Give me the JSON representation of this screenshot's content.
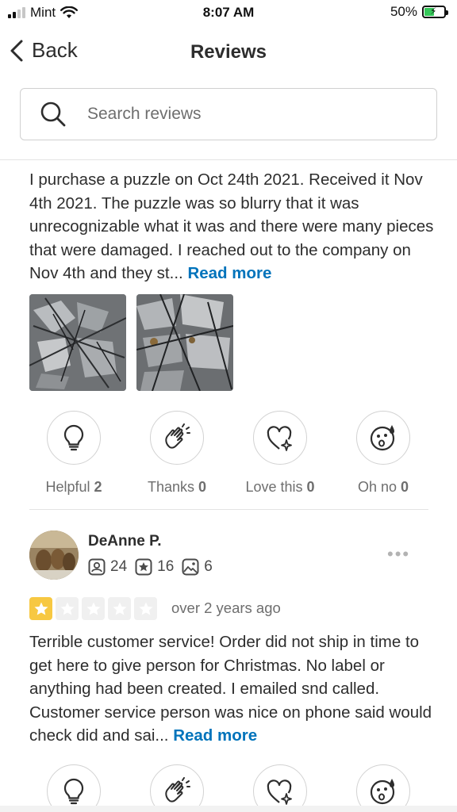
{
  "status_bar": {
    "carrier": "Mint",
    "time": "8:07 AM",
    "battery_percent": "50%",
    "battery_level": 0.5,
    "icons": [
      "signal-icon",
      "wifi-icon",
      "battery-charging-icon"
    ]
  },
  "nav": {
    "back_label": "Back",
    "title": "Reviews"
  },
  "search": {
    "placeholder": "Search reviews"
  },
  "review1": {
    "text": "I purchase a puzzle on Oct 24th 2021.  Received it Nov 4th 2021.  The puzzle was so blurry that it was unrecognizable what it was and there were many pieces that were damaged.  I reached out to the company on Nov 4th and they st...",
    "read_more": "Read more",
    "photo_count_shown": 2,
    "reactions": [
      {
        "label": "Helpful",
        "count": "2",
        "icon": "lightbulb-icon"
      },
      {
        "label": "Thanks",
        "count": "0",
        "icon": "clapping-hands-icon"
      },
      {
        "label": "Love this",
        "count": "0",
        "icon": "heart-sparkle-icon"
      },
      {
        "label": "Oh no",
        "count": "0",
        "icon": "shocked-face-icon"
      }
    ]
  },
  "review2": {
    "reviewer_name": "DeAnne P.",
    "friends_count": "24",
    "reviews_count": "16",
    "photos_count": "6",
    "rating": 1,
    "rating_max": 5,
    "date": "over 2 years ago",
    "text": "Terrible customer service! Order did not ship in time to get here to give person for Christmas. No label or anything had been created. I emailed snd called. Customer service person was nice on phone said would check did and sai...",
    "read_more": "Read more"
  },
  "colors": {
    "link": "#0073bb",
    "star_on": "#f7c842",
    "star_off": "#f0f0f0",
    "text": "#2d2d2d",
    "muted": "#6e6e6e"
  }
}
